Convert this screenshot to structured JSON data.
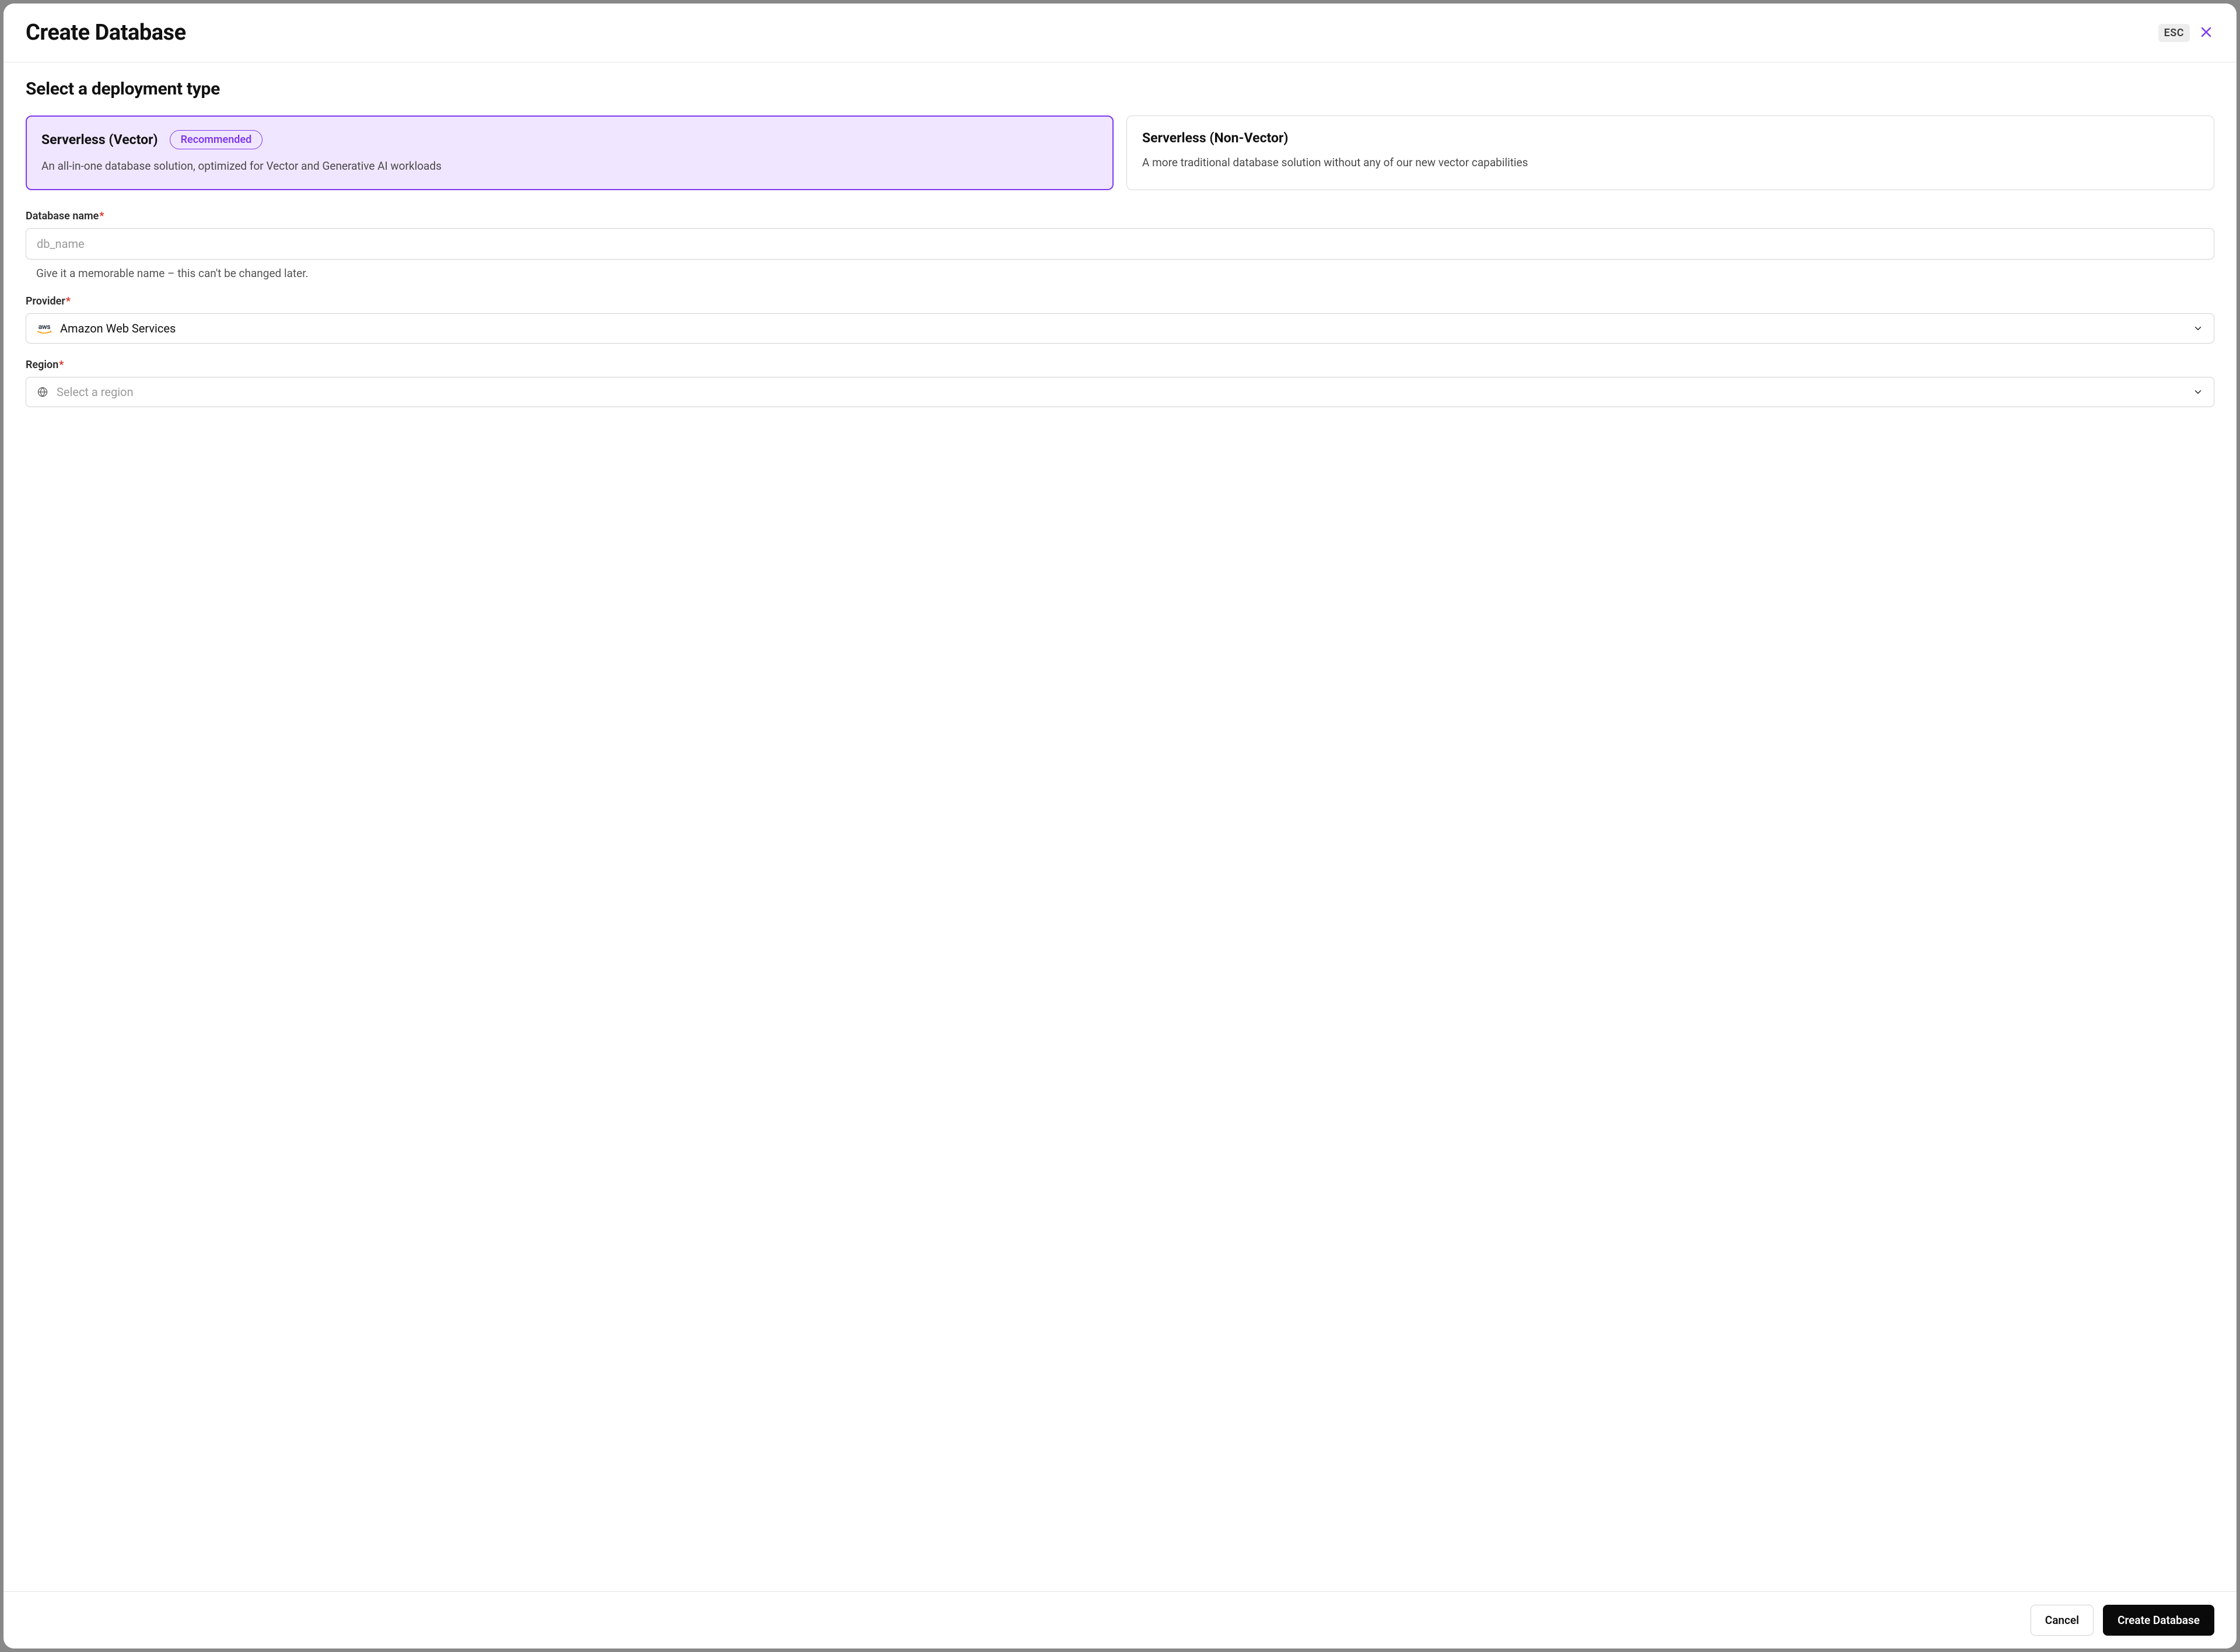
{
  "header": {
    "title": "Create Database",
    "esc_label": "ESC"
  },
  "deployment": {
    "section_title": "Select a deployment type",
    "options": [
      {
        "title": "Serverless (Vector)",
        "badge": "Recommended",
        "desc": "An all-in-one database solution, optimized for Vector and Generative AI workloads",
        "selected": true
      },
      {
        "title": "Serverless (Non-Vector)",
        "desc": "A more traditional database solution without any of our new vector capabilities",
        "selected": false
      }
    ]
  },
  "form": {
    "db_name": {
      "label": "Database name",
      "placeholder": "db_name",
      "value": "",
      "help": "Give it a memorable name – this can't be changed later."
    },
    "provider": {
      "label": "Provider",
      "value": "Amazon Web Services",
      "icon": "aws"
    },
    "region": {
      "label": "Region",
      "placeholder": "Select a region",
      "value": ""
    }
  },
  "footer": {
    "cancel": "Cancel",
    "submit": "Create Database"
  }
}
